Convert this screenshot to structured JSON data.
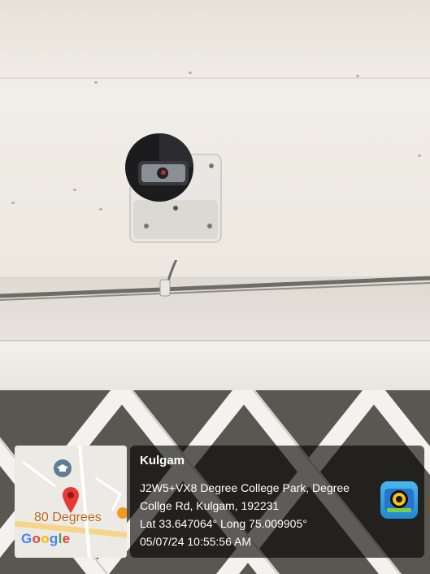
{
  "stamp": {
    "place": "Kulgam",
    "address_line1": "J2W5+VX8 Degree College Park, Degree",
    "address_line2": "Collge Rd, Kulgam, 192231",
    "coordinates": "Lat 33.647064° Long 75.009905°",
    "datetime": "05/07/24 10:55:56 AM"
  },
  "map": {
    "place_label": "80 Degrees",
    "provider_logo": [
      "G",
      "o",
      "o",
      "g",
      "l",
      "e"
    ],
    "pin_color": "#e53935",
    "label_color": "#b5651d"
  },
  "icons": {
    "map_pin": "location-pin-icon",
    "education_marker": "graduation-cap-icon",
    "app": "camera-app-icon"
  },
  "colors": {
    "ceiling": "#f1eee7",
    "overlay": "rgba(0,0,0,0.62)",
    "app_icon": "#1f8ad6"
  }
}
